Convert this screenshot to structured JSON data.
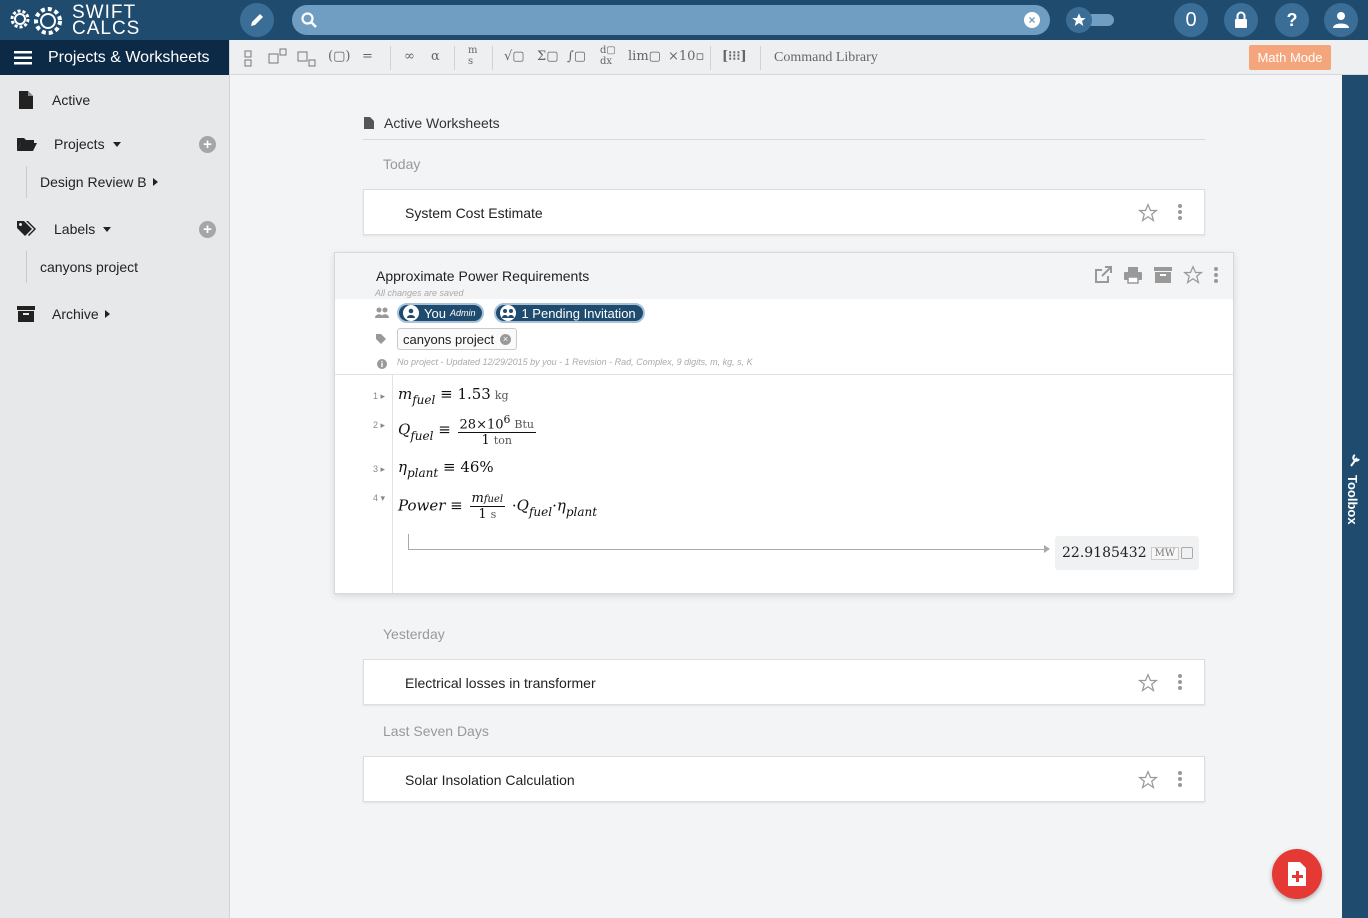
{
  "app": {
    "logo_line1": "SWIFT",
    "logo_line2": "CALCS"
  },
  "topbar": {
    "search_value": "",
    "notification_count": "0",
    "colors": {
      "bar": "#1f4b6f",
      "search": "#6f9ec2"
    }
  },
  "sidebar": {
    "header": "Projects & Worksheets",
    "items": [
      {
        "label": "Active",
        "icon": "file-icon"
      },
      {
        "label": "Projects",
        "icon": "folder-open-icon"
      },
      {
        "label": "Labels",
        "icon": "tags-icon"
      },
      {
        "label": "Archive",
        "icon": "archive-icon"
      }
    ],
    "project_sub": "Design Review B",
    "label_sub": "canyons project"
  },
  "toolbar": {
    "command_library": "Command Library",
    "math_mode": "Math Mode",
    "infinity": "∞",
    "alpha": "α",
    "lim": "lim",
    "sci": "×10"
  },
  "main": {
    "section_title": "Active Worksheets",
    "groups": {
      "today": "Today",
      "yesterday": "Yesterday",
      "last_seven": "Last Seven Days"
    },
    "cards": {
      "system_cost": "System Cost Estimate",
      "electrical": "Electrical losses in transformer",
      "solar": "Solar Insolation Calculation"
    },
    "expanded": {
      "title": "Approximate Power Requirements",
      "saved": "All changes are saved",
      "you": "You",
      "admin": "Admin",
      "pending": "1 Pending Invitation",
      "label": "canyons project",
      "info": "No project  -  Updated 12/29/2015 by you - 1 Revision  -  Rad, Complex, 9 digits, m, kg, s, K",
      "lines": [
        "1",
        "2",
        "3",
        "4"
      ],
      "m_fuel_value": "1.53",
      "m_fuel_unit": "kg",
      "q_num": "28×10",
      "q_exp": "6",
      "q_num_unit": "Btu",
      "q_den": "1",
      "q_den_unit": "ton",
      "eta_value": "46%",
      "power_den": "1",
      "power_den_unit": "s",
      "result_value": "22.9185432",
      "result_unit": "MW"
    }
  },
  "toolbox_label": "Toolbox",
  "accent_colors": {
    "fab": "#e53935",
    "math_mode": "#f5a57c",
    "nav_dark": "#0c2a46"
  }
}
